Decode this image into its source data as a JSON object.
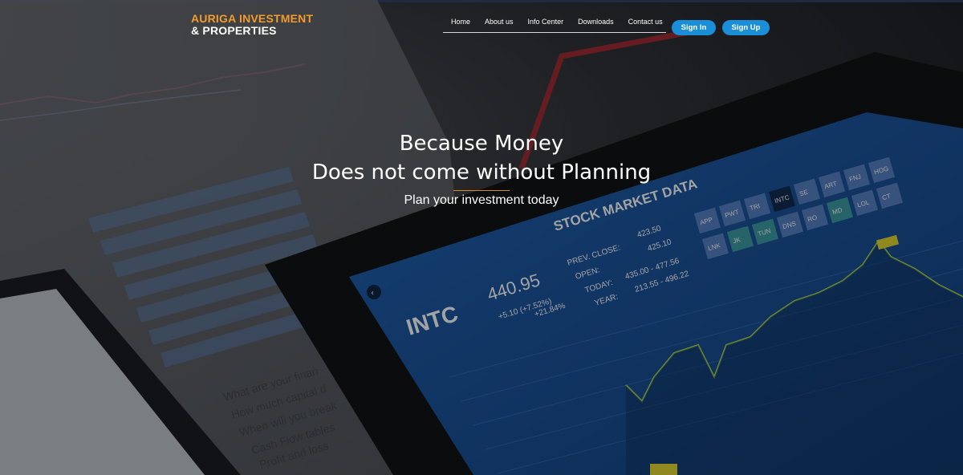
{
  "brand": {
    "line1": "AURIGA INVESTMENT",
    "line2": "& PROPERTIES",
    "accent_color": "#f29b2e"
  },
  "nav": {
    "items": [
      {
        "label": "Home"
      },
      {
        "label": "About us"
      },
      {
        "label": "Info Center"
      },
      {
        "label": "Downloads"
      },
      {
        "label": "Contact us"
      }
    ]
  },
  "auth": {
    "signin_label": "Sign In",
    "signup_label": "Sign Up",
    "button_color": "#1a8fd8"
  },
  "hero": {
    "headline_line1": "Because Money",
    "headline_line2": "Does not come without Planning",
    "subheadline": "Plan your investment today",
    "tablet": {
      "heading": "STOCK MARKET DATA",
      "ticker": "INTC",
      "price": "440.95",
      "change": "+5.10 (+7.52%)",
      "change_6m": "+21.84%",
      "prev_close_label": "PREV. CLOSE:",
      "prev_close_value": "423.50",
      "open_label": "OPEN:",
      "open_value": "425.10",
      "today_label": "TODAY:",
      "today_value": "435.00 - 477.56",
      "year_label": "YEAR:",
      "year_value": "213.55 - 496.22",
      "tiles": [
        "APP",
        "PWT",
        "TRI",
        "INTC",
        "SE",
        "ART",
        "FNJ",
        "HOG",
        "LNK",
        "JK",
        "TUN",
        "DNS",
        "RO",
        "MD",
        "LOL",
        "CT"
      ]
    },
    "paper": {
      "questions": [
        "What are your finan",
        "How much capital d",
        "When will you break",
        "Cash Flow tables",
        "Profit and loss"
      ]
    }
  }
}
